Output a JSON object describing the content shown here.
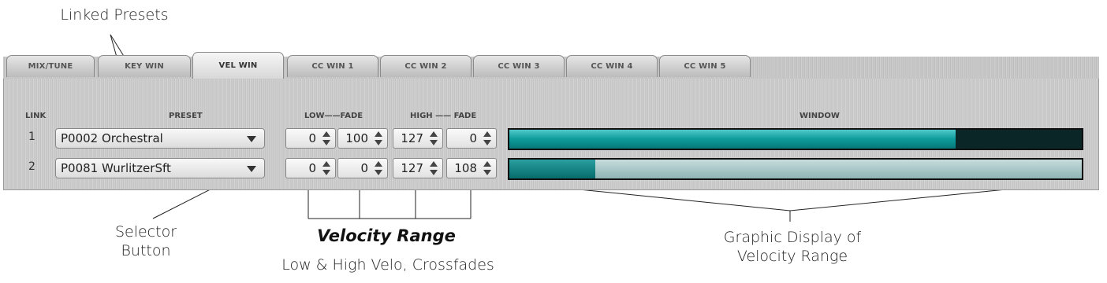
{
  "annotations": {
    "linked_presets": "Linked Presets",
    "selector_button": "Selector\nButton",
    "velocity_range_title": "Velocity Range",
    "velocity_range_sub": "Low & High Velo, Crossfades",
    "graphic_display": "Graphic Display of\nVelocity Range"
  },
  "tabs": [
    {
      "label": "MIX/TUNE",
      "active": false
    },
    {
      "label": "KEY WIN",
      "active": false
    },
    {
      "label": "VEL WIN",
      "active": true
    },
    {
      "label": "CC WIN 1",
      "active": false
    },
    {
      "label": "CC WIN 2",
      "active": false
    },
    {
      "label": "CC WIN 3",
      "active": false
    },
    {
      "label": "CC WIN 4",
      "active": false
    },
    {
      "label": "CC WIN 5",
      "active": false
    }
  ],
  "headers": {
    "link": "LINK",
    "preset": "PRESET",
    "low_fade": "LOW——FADE",
    "high_fade": "HIGH —— FADE",
    "window": "WINDOW"
  },
  "rows": [
    {
      "num": "1",
      "preset": "P0002 Orchestral",
      "low": "0",
      "low_fade": "100",
      "high": "127",
      "high_fade": "0",
      "window_fill": [
        0.0,
        0.78
      ],
      "window_dark": [
        0.78,
        1.0
      ]
    },
    {
      "num": "2",
      "preset": "P0081 WurlitzerSft",
      "low": "0",
      "low_fade": "0",
      "high": "127",
      "high_fade": "108",
      "window_fill": [
        0.0,
        0.15
      ],
      "window_dark": [
        0.0,
        0.15
      ]
    }
  ],
  "colors": {
    "teal": "#0e9b9b",
    "dark_teal": "#0a2626"
  }
}
